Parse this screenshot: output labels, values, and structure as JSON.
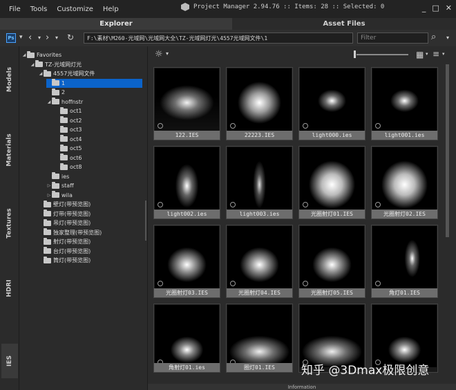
{
  "menu": [
    "File",
    "Tools",
    "Customize",
    "Help"
  ],
  "titlebar": {
    "text": "Project Manager 2.94.76  :: Items: 28  :: Selected: 0"
  },
  "window_controls": [
    "_",
    "□",
    "✕"
  ],
  "tabs": {
    "explorer": "Explorer",
    "asset_files": "Asset Files"
  },
  "pathbar": {
    "ps_badge": "Ps",
    "path": "F:\\素材\\M260-光域网\\光域网大全\\TZ-光域网灯光\\4557光域网文件\\1",
    "filter_placeholder": "Filter"
  },
  "rail": [
    "Models",
    "Materials",
    "Textures",
    "HDRI",
    "IES"
  ],
  "tree": [
    {
      "label": "Favorites",
      "depth": 0,
      "caret": "◢"
    },
    {
      "label": "TZ-光域网灯光",
      "depth": 1,
      "caret": "◢"
    },
    {
      "label": "4557光域网文件",
      "depth": 2,
      "caret": "◢"
    },
    {
      "label": "1",
      "depth": 3,
      "caret": "",
      "selected": true
    },
    {
      "label": "2",
      "depth": 3,
      "caret": ""
    },
    {
      "label": "hoffnstr",
      "depth": 3,
      "caret": "◢"
    },
    {
      "label": "oct1",
      "depth": 4,
      "caret": ""
    },
    {
      "label": "oct2",
      "depth": 4,
      "caret": ""
    },
    {
      "label": "oct3",
      "depth": 4,
      "caret": ""
    },
    {
      "label": "oct4",
      "depth": 4,
      "caret": ""
    },
    {
      "label": "oct5",
      "depth": 4,
      "caret": ""
    },
    {
      "label": "oct6",
      "depth": 4,
      "caret": ""
    },
    {
      "label": "oct8",
      "depth": 4,
      "caret": ""
    },
    {
      "label": "ies",
      "depth": 3,
      "caret": ""
    },
    {
      "label": "staff",
      "depth": 3,
      "caret": "▷"
    },
    {
      "label": "wila",
      "depth": 3,
      "caret": "▷"
    },
    {
      "label": "壁灯(带预览图)",
      "depth": 2,
      "caret": ""
    },
    {
      "label": "灯带(带预览图)",
      "depth": 2,
      "caret": ""
    },
    {
      "label": "吊灯(带预览图)",
      "depth": 2,
      "caret": ""
    },
    {
      "label": "独家整理(带预览图)",
      "depth": 2,
      "caret": ""
    },
    {
      "label": "射灯(带预览图)",
      "depth": 2,
      "caret": ""
    },
    {
      "label": "台灯(带预览图)",
      "depth": 2,
      "caret": ""
    },
    {
      "label": "筒灯(带预览图)",
      "depth": 2,
      "caret": ""
    }
  ],
  "tiles": [
    {
      "name": "122.IES",
      "style": "fan"
    },
    {
      "name": "22223.IES",
      "style": "wide"
    },
    {
      "name": "light000.ies",
      "style": "small"
    },
    {
      "name": "light001.ies",
      "style": "small"
    },
    {
      "name": "light002.ies",
      "style": "narrow"
    },
    {
      "name": "light003.ies",
      "style": "thin"
    },
    {
      "name": "光圈射灯01.IES",
      "style": "big"
    },
    {
      "name": "光圈射灯02.IES",
      "style": "big"
    },
    {
      "name": "光圈射灯03.IES",
      "style": "cone"
    },
    {
      "name": "光圈射灯04.IES",
      "style": "cone"
    },
    {
      "name": "光圈射灯05.IES",
      "style": "cone"
    },
    {
      "name": "角灯01.IES",
      "style": "side"
    },
    {
      "name": "角射灯01.ies",
      "style": "low"
    },
    {
      "name": "圈灯01.IES",
      "style": "ring"
    },
    {
      "name": "",
      "style": "ring"
    },
    {
      "name": "",
      "style": "low"
    }
  ],
  "info_label": "Information",
  "watermark": "知乎 @3Dmax极限创意"
}
